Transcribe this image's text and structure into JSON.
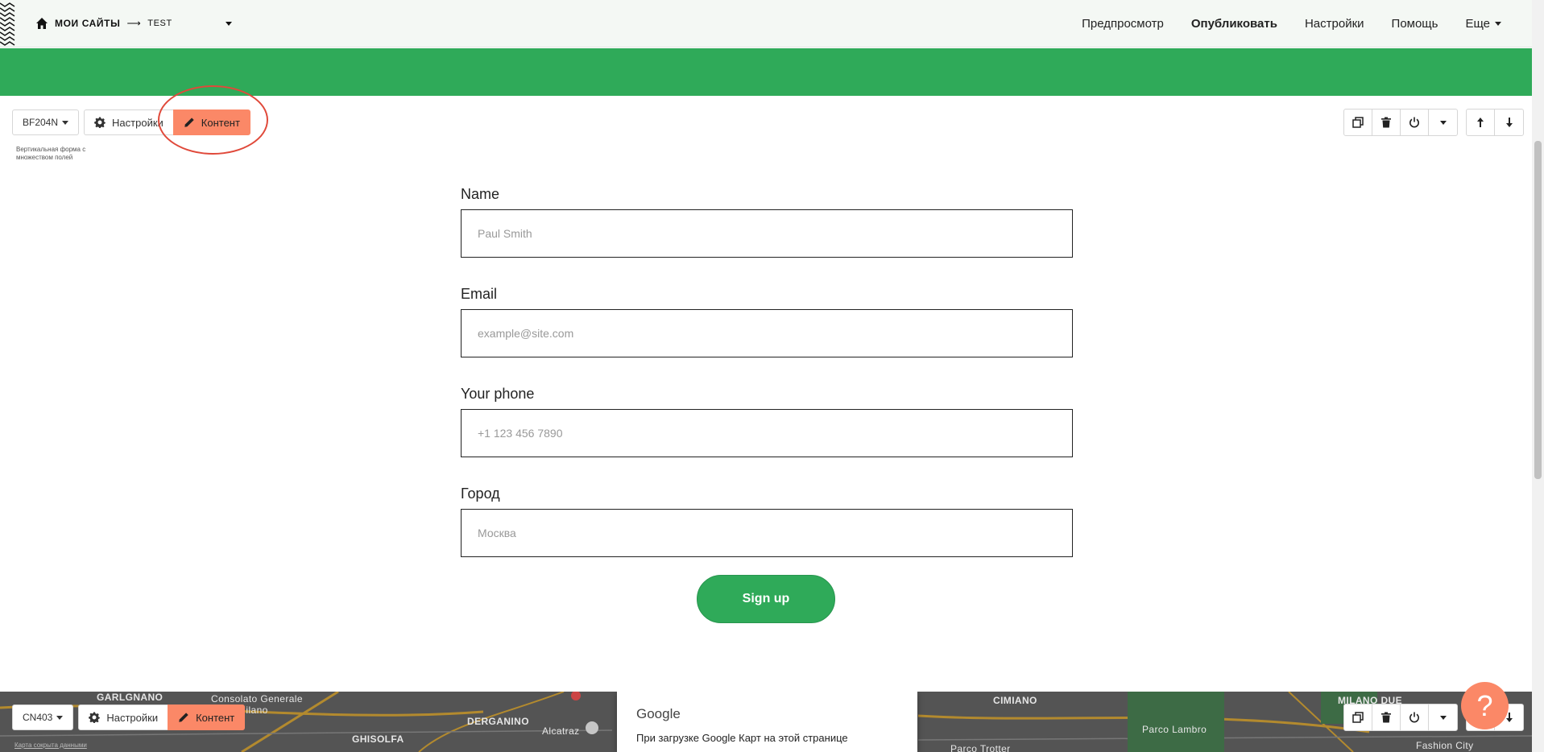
{
  "topbar": {
    "my_sites": "МОИ САЙТЫ",
    "arrow": "⟶",
    "site_name": "TEST",
    "nav": {
      "preview": "Предпросмотр",
      "publish": "Опубликовать",
      "settings": "Настройки",
      "help": "Помощь",
      "more": "Еще"
    }
  },
  "colors": {
    "accent_green": "#2faa59",
    "content_button": "#fb8867",
    "annotation_red": "#e0493a"
  },
  "block1": {
    "code": "BF204N",
    "settings_label": "Настройки",
    "content_label": "Контент",
    "description": "Вертикальная форма с множеством полей"
  },
  "form": {
    "fields": [
      {
        "label": "Name",
        "placeholder": "Paul Smith"
      },
      {
        "label": "Email",
        "placeholder": "example@site.com"
      },
      {
        "label": "Your phone",
        "placeholder": "+1 123 456 7890"
      },
      {
        "label": "Город",
        "placeholder": "Москва"
      }
    ],
    "submit": "Sign up"
  },
  "block2": {
    "code": "CN403",
    "settings_label": "Настройки",
    "content_label": "Контент"
  },
  "map": {
    "labels": {
      "garlgnano": "GARLGNANO",
      "consolato": "Consolato Generale",
      "milano": "Milano",
      "ghisolfa": "GHISOLFA",
      "derganino": "DERGANINO",
      "alcatraz": "Alcatraz",
      "cimiano": "CIMIANO",
      "milano_due": "MILANO DUE",
      "parco_lambro": "Parco Lambro",
      "parco_trotter": "Parco Trotter",
      "fashion_city": "Fashion City"
    },
    "caption": "Карта сокрыта данными",
    "google_title": "Google",
    "google_text": "При загрузке Google Карт на этой странице"
  },
  "help_button": "?"
}
